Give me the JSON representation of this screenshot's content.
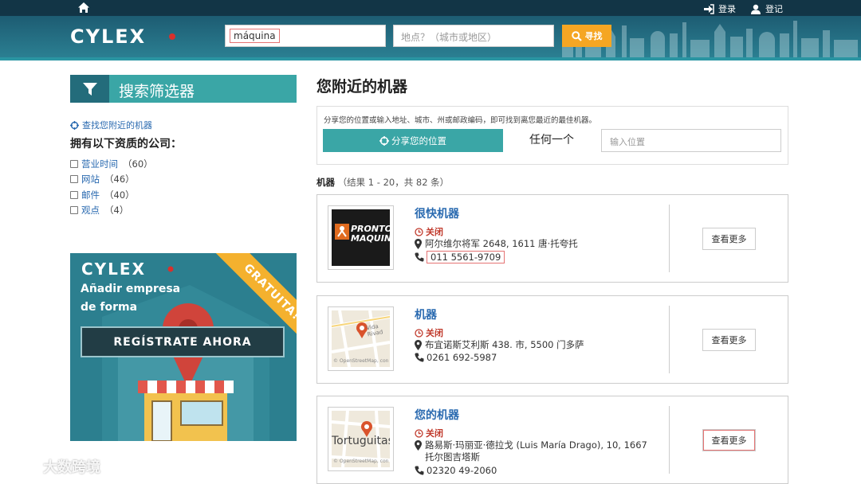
{
  "topbar": {
    "login_label": "登录",
    "register_label": "登记"
  },
  "header": {
    "logo_text": "CYLEX",
    "search_value": "máquina",
    "location_placeholder": "地点？（城市或地区）",
    "search_button": "寻找"
  },
  "sidebar": {
    "filter_title": "搜索筛选器",
    "nearby_link": "查找您附近的机器",
    "qualification_heading": "拥有以下资质的公司：",
    "filters": [
      {
        "label": "营业时间",
        "count": "（60）"
      },
      {
        "label": "网站",
        "count": "（46）"
      },
      {
        "label": "邮件",
        "count": "（40）"
      },
      {
        "label": "观点",
        "count": "（4）"
      }
    ],
    "promo": {
      "logo_text": "CYLEX",
      "line1": "Añadir empresa",
      "line2": "de forma",
      "ribbon": "GRATUITA!",
      "cta": "REGÍSTRATE AHORA"
    }
  },
  "main": {
    "title": "您附近的机器",
    "share_hint": "分享您的位置或输入地址、城市、州或邮政编码，即可找到离您最近的最佳机器。",
    "share_button": "分享您的位置",
    "any_label": "任何一个",
    "location_placeholder": "输入位置",
    "results_label": "机器",
    "results_range": "（结果 1 - 20，共 82 条）",
    "listings": [
      {
        "name": "很快机器",
        "status": "关闭",
        "address": "阿尔维尔将军 2648, 1611 唐·托夸托",
        "phone": "011 5561-9709",
        "more": "查看更多",
        "thumb_line1": "PRONTO",
        "thumb_line2": "MAQUINA"
      },
      {
        "name": "机器",
        "status": "关闭",
        "address": "布宜诺斯艾利斯 438. 市, 5500 门多萨",
        "phone": "0261 692-5987",
        "more": "查看更多",
        "map_street": "Vida Rivad",
        "map_credit": "© OpenStreetMap, con"
      },
      {
        "name": "您的机器",
        "status": "关闭",
        "address": "路易斯·玛丽亚·德拉戈 (Luis María Drago), 10, 1667 托尔图吉塔斯",
        "phone": "02320 49-2060",
        "more": "查看更多",
        "map_street": "Tortuguitas",
        "map_credit": "© OpenStreetMap, con"
      }
    ]
  },
  "watermark": "大数跨境"
}
